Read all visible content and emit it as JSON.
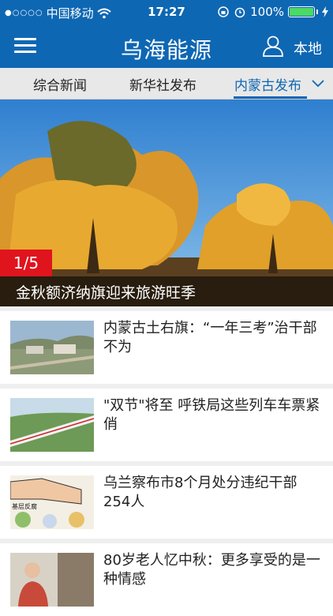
{
  "status_bar": {
    "signal_dots": "●○○○○",
    "carrier": "中国移动",
    "time": "17:27",
    "battery_percent": "100%"
  },
  "header": {
    "title": "乌海能源",
    "location_label": "本地"
  },
  "tabs": [
    {
      "label": "综合新闻",
      "active": false
    },
    {
      "label": "新华社发布",
      "active": false
    },
    {
      "label": "内蒙古发布",
      "active": true
    }
  ],
  "hero": {
    "counter": "1/5",
    "caption": "金秋额济纳旗迎来旅游旺季"
  },
  "news": [
    {
      "title": "内蒙古土右旗：“一年三考”治干部不为"
    },
    {
      "title": "\"双节\"将至 呼铁局这些列车车票紧俏"
    },
    {
      "title": "乌兰察布市8个月处分违纪干部254人",
      "thumb_text": "基层反腐"
    },
    {
      "title": "80岁老人忆中秋：更多享受的是一种情感"
    }
  ],
  "colors": {
    "brand_blue": "#0e67b3",
    "counter_red": "#e0141d",
    "battery_green": "#4cd964"
  }
}
